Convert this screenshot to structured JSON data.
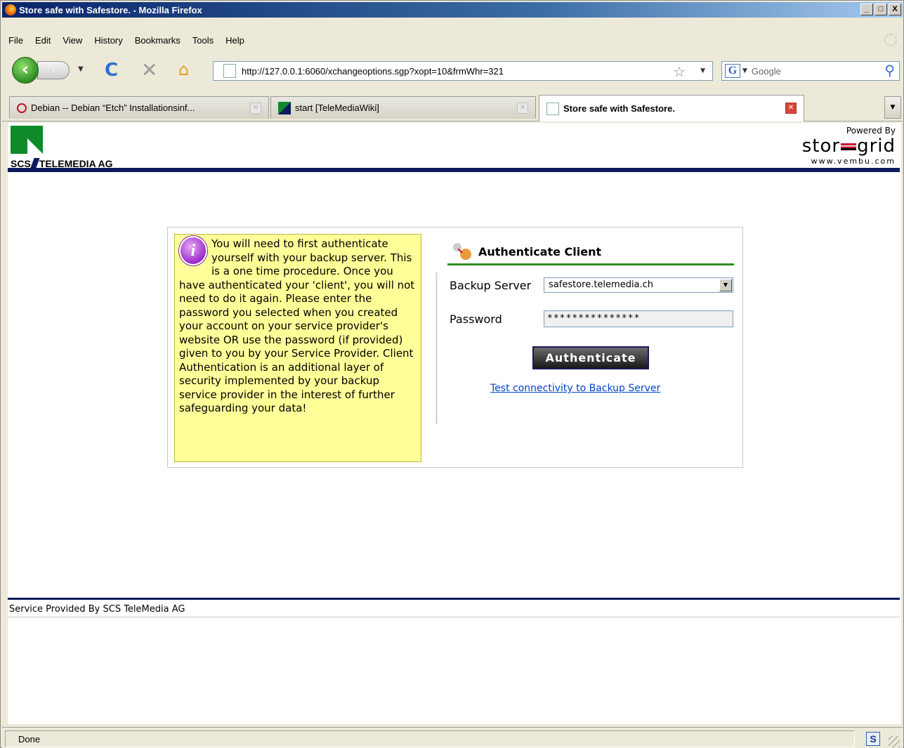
{
  "window": {
    "title": "Store safe with Safestore. - Mozilla Firefox",
    "minimize": "_",
    "maximize": "□",
    "close": "X"
  },
  "menu": [
    "File",
    "Edit",
    "View",
    "History",
    "Bookmarks",
    "Tools",
    "Help"
  ],
  "nav": {
    "url": "http://127.0.0.1:6060/xchangeoptions.sgp?xopt=10&frmWhr=321",
    "search_placeholder": "Google",
    "back_glyph": "‹",
    "forward_glyph": "›",
    "reload_glyph": "C",
    "stop_glyph": "✕",
    "home_glyph": "⌂",
    "star_glyph": "☆",
    "search_glyph": "⚲",
    "google_letter": "G"
  },
  "tabs": [
    {
      "label": "Debian -- Debian “Etch” Installationsinf...",
      "active": false
    },
    {
      "label": "start [TeleMediaWiki]",
      "active": false
    },
    {
      "label": "Store safe with Safestore.",
      "active": true
    }
  ],
  "page": {
    "logo_left": "SCS",
    "logo_right": "TELEMEDIA AG",
    "powered_by": "Powered By",
    "brand_left": "stor",
    "brand_right": "grid",
    "brand_url": "www.vembu.com",
    "info_text": "You will need to first authenticate yourself with your backup server. This is a one time procedure. Once you have authenticated your 'client', you will not need to do it again. Please enter the password you selected when you created your account on your service provider's website OR use the password (if provided) given to you by your Service Provider. Client Authentication is an additional layer of security implemented by your backup service provider in the interest of further safeguarding your data!",
    "info_glyph": "i",
    "auth_title": "Authenticate Client",
    "backup_server_label": "Backup Server",
    "backup_server_value": "safestore.telemedia.ch",
    "password_label": "Password",
    "password_value": "***************",
    "authenticate_button": "Authenticate",
    "test_link": "Test connectivity to Backup Server",
    "footer": "Service Provided By SCS TeleMedia AG"
  },
  "status": {
    "text": "Done",
    "s_icon": "S"
  }
}
